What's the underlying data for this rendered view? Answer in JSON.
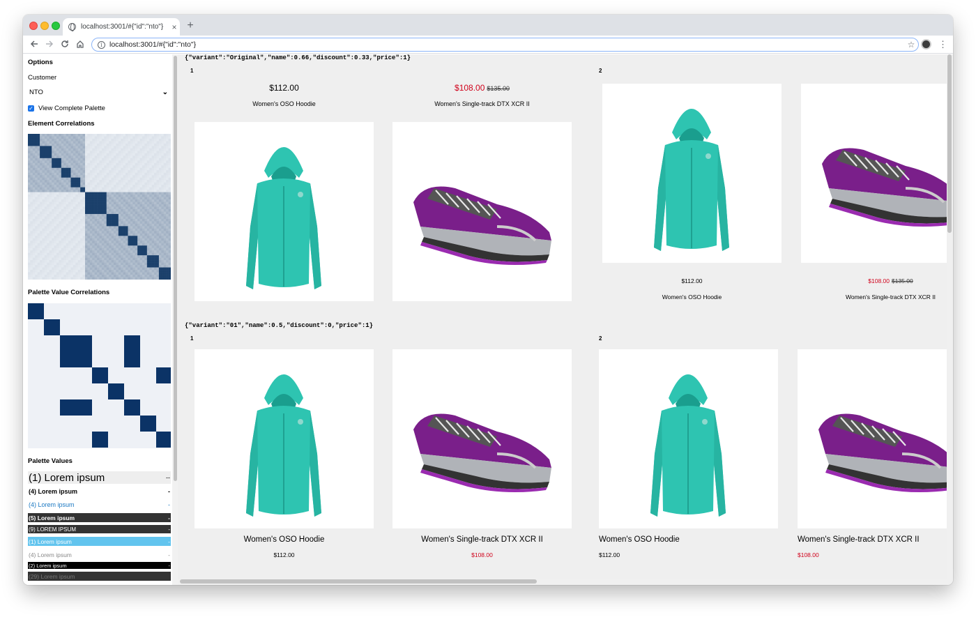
{
  "browser": {
    "tab_title": "localhost:3001/#{\"id\":\"nto\"}",
    "tab_close": "×",
    "new_tab": "+",
    "url": "localhost:3001/#{\"id\":\"nto\"}",
    "info_icon": "i"
  },
  "sidebar": {
    "options_heading": "Options",
    "customer_label": "Customer",
    "customer_value": "NTO",
    "view_palette_label": "View Complete Palette",
    "view_palette_checked": true,
    "element_corr_heading": "Element Correlations",
    "palette_corr_heading": "Palette Value Correlations",
    "palette_values_heading": "Palette Values",
    "palette_values": [
      {
        "text": "(1) Lorem ipsum",
        "tail": "--"
      },
      {
        "text": "(4) Lorem ipsum",
        "tail": "-"
      },
      {
        "text": "(4) Lorem ipsum",
        "tail": "-"
      },
      {
        "text": "(5) Lorem ipsum",
        "tail": "-"
      },
      {
        "text": "(9) LOREM IPSUM",
        "tail": "-"
      },
      {
        "text": "(1) Lorem ipsum",
        "tail": "-"
      },
      {
        "text": "(4) Lorem ipsum",
        "tail": "-"
      },
      {
        "text": "(2) Lorem ipsum",
        "tail": "-"
      },
      {
        "text": "(29) Lorem ipsum",
        "tail": ""
      }
    ],
    "colors": {
      "dark_navy": "#0b3366",
      "light_blue_row": "#62c4ee",
      "link_blue": "#1a78c2"
    }
  },
  "variants": [
    {
      "json": "{\"variant\":\"Original\",\"name\":0.66,\"discount\":0.33,\"price\":1}",
      "group1_label": "1",
      "group2_label": "2"
    },
    {
      "json": "{\"variant\":\"01\",\"name\":0.5,\"discount\":0,\"price\":1}",
      "group1_label": "1",
      "group2_label": "2"
    }
  ],
  "products": {
    "hoodie": {
      "name": "Women's OSO Hoodie",
      "price": "$112.00"
    },
    "shoe": {
      "name": "Women's Single-track DTX XCR II",
      "sale_price": "$108.00",
      "original_price": "$135.00"
    }
  }
}
